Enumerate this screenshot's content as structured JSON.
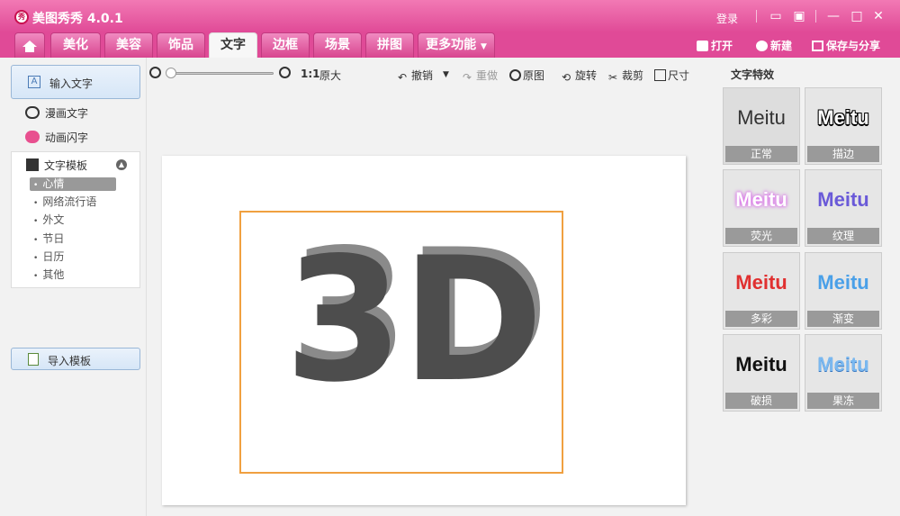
{
  "app": {
    "title": "美图秀秀 4.0.1",
    "logo_text": "秀",
    "login": "登录"
  },
  "tabs": [
    {
      "label": "美化",
      "active": false
    },
    {
      "label": "美容",
      "active": false
    },
    {
      "label": "饰品",
      "active": false
    },
    {
      "label": "文字",
      "active": true
    },
    {
      "label": "边框",
      "active": false
    },
    {
      "label": "场景",
      "active": false
    },
    {
      "label": "拼图",
      "active": false
    },
    {
      "label": "更多功能",
      "active": false
    }
  ],
  "actions": {
    "open": "打开",
    "new": "新建",
    "save": "保存与分享"
  },
  "left": {
    "input_text": "输入文字",
    "comic_text": "漫画文字",
    "anim_text": "动画闪字",
    "template_header": "文字模板",
    "categories": [
      "心情",
      "网络流行语",
      "外文",
      "节日",
      "日历",
      "其他"
    ],
    "selected_category": "心情",
    "import_template": "导入模板"
  },
  "toolbar": {
    "ratio": "1:1",
    "original_size": "原大",
    "undo": "撤销",
    "redo": "重做",
    "original": "原图",
    "rotate": "旋转",
    "crop": "裁剪",
    "size": "尺寸"
  },
  "canvas": {
    "text": "3D"
  },
  "effects": {
    "title": "文字特效",
    "items": [
      {
        "sample": "Meitu",
        "label": "正常"
      },
      {
        "sample": "Meitu",
        "label": "描边"
      },
      {
        "sample": "Meitu",
        "label": "荧光"
      },
      {
        "sample": "Meitu",
        "label": "纹理"
      },
      {
        "sample": "Meitu",
        "label": "多彩"
      },
      {
        "sample": "Meitu",
        "label": "渐变"
      },
      {
        "sample": "Meitu",
        "label": "破损"
      },
      {
        "sample": "Meitu",
        "label": "果冻"
      }
    ]
  },
  "colors": {
    "brand": "#e04a97",
    "selection": "#f0a040",
    "text3d": "#4d4d4d"
  }
}
